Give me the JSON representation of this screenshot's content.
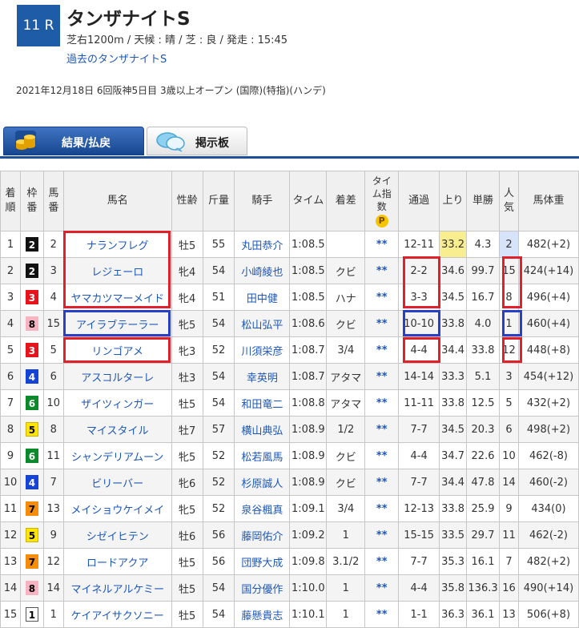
{
  "header": {
    "race_no": "11 R",
    "title": "タンザナイトS",
    "info": "芝右1200m / 天候 : 晴 / 芝 : 良 / 発走 : 15:45",
    "past_link": "過去のタンザナイトS",
    "date_line": "2021年12月18日 6回阪神5日目 3歳以上オープン (国際)(特指)(ハンデ)"
  },
  "tabs": [
    {
      "label": "結果/払戻",
      "icon": "coin-stack-icon",
      "active": true
    },
    {
      "label": "掲示板",
      "icon": "speech-bubble-icon",
      "active": false
    }
  ],
  "columns": [
    "着順",
    "枠番",
    "馬番",
    "馬名",
    "性齢",
    "斤量",
    "騎手",
    "タイム",
    "着差",
    "タイム指数",
    "通過",
    "上り",
    "単勝",
    "人気",
    "馬体重"
  ],
  "time_index_icon": "P",
  "colors": {
    "accent": "#1f5ca8",
    "link": "#1d57b8",
    "highlight_red": "#e0202a",
    "highlight_blue": "#2a3fc8"
  },
  "rows": [
    {
      "rank": "1",
      "waku": "2",
      "umaban": "2",
      "name": "ナランフレグ",
      "sexage": "牡5",
      "kin": "55",
      "jockey": "丸田恭介",
      "time": "1:08.5",
      "margin": "",
      "idx": "**",
      "pass": "12-11",
      "agari": "33.2",
      "odds": "4.3",
      "pop": "2",
      "weight": "482(+2)"
    },
    {
      "rank": "2",
      "waku": "2",
      "umaban": "3",
      "name": "レジェーロ",
      "sexage": "牝4",
      "kin": "54",
      "jockey": "小崎綾也",
      "time": "1:08.5",
      "margin": "クビ",
      "idx": "**",
      "pass": "2-2",
      "agari": "34.6",
      "odds": "99.7",
      "pop": "15",
      "weight": "424(+14)"
    },
    {
      "rank": "3",
      "waku": "3",
      "umaban": "4",
      "name": "ヤマカツマーメイド",
      "sexage": "牝4",
      "kin": "51",
      "jockey": "田中健",
      "time": "1:08.5",
      "margin": "ハナ",
      "idx": "**",
      "pass": "3-3",
      "agari": "34.5",
      "odds": "16.7",
      "pop": "8",
      "weight": "496(+4)"
    },
    {
      "rank": "4",
      "waku": "8",
      "umaban": "15",
      "name": "アイラブテーラー",
      "sexage": "牝5",
      "kin": "54",
      "jockey": "松山弘平",
      "time": "1:08.6",
      "margin": "クビ",
      "idx": "**",
      "pass": "10-10",
      "agari": "33.8",
      "odds": "4.0",
      "pop": "1",
      "weight": "460(+4)"
    },
    {
      "rank": "5",
      "waku": "3",
      "umaban": "5",
      "name": "リンゴアメ",
      "sexage": "牝3",
      "kin": "52",
      "jockey": "川須栄彦",
      "time": "1:08.7",
      "margin": "3/4",
      "idx": "**",
      "pass": "4-4",
      "agari": "34.4",
      "odds": "33.8",
      "pop": "12",
      "weight": "448(+8)"
    },
    {
      "rank": "6",
      "waku": "4",
      "umaban": "6",
      "name": "アスコルターレ",
      "sexage": "牡3",
      "kin": "54",
      "jockey": "幸英明",
      "time": "1:08.7",
      "margin": "アタマ",
      "idx": "**",
      "pass": "14-14",
      "agari": "33.3",
      "odds": "5.1",
      "pop": "3",
      "weight": "454(+12)"
    },
    {
      "rank": "7",
      "waku": "6",
      "umaban": "10",
      "name": "ザイツィンガー",
      "sexage": "牡5",
      "kin": "54",
      "jockey": "和田竜二",
      "time": "1:08.8",
      "margin": "アタマ",
      "idx": "**",
      "pass": "11-11",
      "agari": "33.8",
      "odds": "12.5",
      "pop": "5",
      "weight": "432(+2)"
    },
    {
      "rank": "8",
      "waku": "5",
      "umaban": "8",
      "name": "マイスタイル",
      "sexage": "牡7",
      "kin": "57",
      "jockey": "横山典弘",
      "time": "1:08.9",
      "margin": "1/2",
      "idx": "**",
      "pass": "7-7",
      "agari": "34.5",
      "odds": "20.3",
      "pop": "6",
      "weight": "498(+2)"
    },
    {
      "rank": "9",
      "waku": "6",
      "umaban": "11",
      "name": "シャンデリアムーン",
      "sexage": "牝5",
      "kin": "52",
      "jockey": "松若風馬",
      "time": "1:08.9",
      "margin": "クビ",
      "idx": "**",
      "pass": "4-4",
      "agari": "34.7",
      "odds": "22.6",
      "pop": "10",
      "weight": "462(-8)"
    },
    {
      "rank": "10",
      "waku": "4",
      "umaban": "7",
      "name": "ビリーバー",
      "sexage": "牝6",
      "kin": "52",
      "jockey": "杉原誠人",
      "time": "1:08.9",
      "margin": "クビ",
      "idx": "**",
      "pass": "7-7",
      "agari": "34.4",
      "odds": "47.8",
      "pop": "14",
      "weight": "460(-2)"
    },
    {
      "rank": "11",
      "waku": "7",
      "umaban": "13",
      "name": "メイショウケイメイ",
      "sexage": "牝5",
      "kin": "52",
      "jockey": "泉谷楓真",
      "time": "1:09.1",
      "margin": "3/4",
      "idx": "**",
      "pass": "12-13",
      "agari": "33.8",
      "odds": "25.9",
      "pop": "9",
      "weight": "434(0)"
    },
    {
      "rank": "12",
      "waku": "5",
      "umaban": "9",
      "name": "シゼイヒテン",
      "sexage": "牡6",
      "kin": "56",
      "jockey": "藤岡佑介",
      "time": "1:09.2",
      "margin": "1",
      "idx": "**",
      "pass": "15-15",
      "agari": "33.5",
      "odds": "29.7",
      "pop": "11",
      "weight": "462(-2)"
    },
    {
      "rank": "13",
      "waku": "7",
      "umaban": "12",
      "name": "ロードアクア",
      "sexage": "牡5",
      "kin": "56",
      "jockey": "団野大成",
      "time": "1:09.8",
      "margin": "3.1/2",
      "idx": "**",
      "pass": "7-7",
      "agari": "35.3",
      "odds": "16.1",
      "pop": "7",
      "weight": "482(+2)"
    },
    {
      "rank": "14",
      "waku": "8",
      "umaban": "14",
      "name": "マイネルアルケミー",
      "sexage": "牡5",
      "kin": "54",
      "jockey": "国分優作",
      "time": "1:10.0",
      "margin": "1",
      "idx": "**",
      "pass": "4-4",
      "agari": "35.8",
      "odds": "136.3",
      "pop": "16",
      "weight": "490(+14)"
    },
    {
      "rank": "15",
      "waku": "1",
      "umaban": "1",
      "name": "ケイアイサクソニー",
      "sexage": "牡5",
      "kin": "54",
      "jockey": "藤懸貴志",
      "time": "1:10.1",
      "margin": "1",
      "idx": "**",
      "pass": "1-1",
      "agari": "36.3",
      "odds": "36.1",
      "pop": "13",
      "weight": "506(+8)"
    }
  ]
}
